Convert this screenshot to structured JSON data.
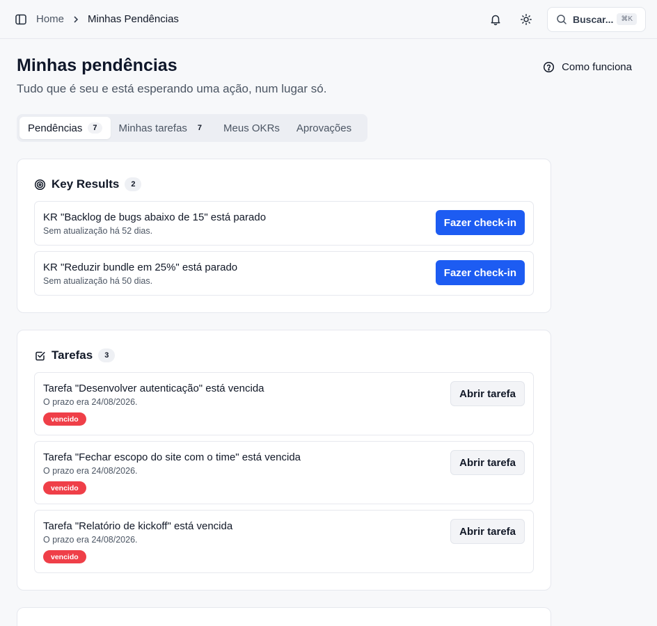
{
  "breadcrumb": {
    "home": "Home",
    "current": "Minhas Pendências"
  },
  "search": {
    "label": "Buscar...",
    "shortcut": "⌘K"
  },
  "header": {
    "title": "Minhas pendências",
    "subtitle": "Tudo que é seu e está esperando uma ação, num lugar só.",
    "how_it_works": "Como funciona"
  },
  "tabs": [
    {
      "label": "Pendências",
      "count": "7",
      "active": true
    },
    {
      "label": "Minhas tarefas",
      "count": "7",
      "active": false
    },
    {
      "label": "Meus OKRs",
      "count": "",
      "active": false
    },
    {
      "label": "Aprovações",
      "count": "",
      "active": false
    }
  ],
  "key_results": {
    "title": "Key Results",
    "count": "2",
    "items": [
      {
        "title": "KR \"Backlog de bugs abaixo de 15\" está parado",
        "subtitle": "Sem atualização há 52 dias.",
        "action": "Fazer check-in"
      },
      {
        "title": "KR \"Reduzir bundle em 25%\" está parado",
        "subtitle": "Sem atualização há 50 dias.",
        "action": "Fazer check-in"
      }
    ]
  },
  "tasks": {
    "title": "Tarefas",
    "count": "3",
    "items": [
      {
        "title": "Tarefa \"Desenvolver autenticação\" está vencida",
        "subtitle": "O prazo era 24/08/2026.",
        "tag": "vencido",
        "action": "Abrir tarefa"
      },
      {
        "title": "Tarefa \"Fechar escopo do site com o time\" está vencida",
        "subtitle": "O prazo era 24/08/2026.",
        "tag": "vencido",
        "action": "Abrir tarefa"
      },
      {
        "title": "Tarefa \"Relatório de kickoff\" está vencida",
        "subtitle": "O prazo era 24/08/2026.",
        "tag": "vencido",
        "action": "Abrir tarefa"
      }
    ]
  },
  "colors": {
    "primary": "#1d5cf2",
    "danger": "#ef3f48",
    "background": "#f7f8fa"
  },
  "icons": {
    "sidebar_toggle": "sidebar-toggle-icon",
    "breadcrumb_separator": "chevron-right-icon",
    "notifications": "bell-icon",
    "theme": "sun-icon",
    "search": "search-icon",
    "help": "help-circle-icon",
    "key_results": "target-icon",
    "tasks": "checkbox-icon"
  }
}
